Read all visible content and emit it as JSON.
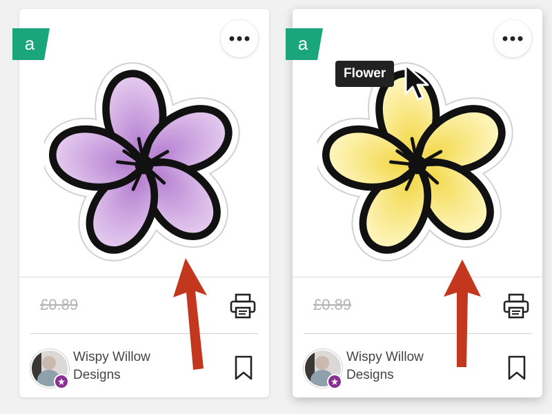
{
  "cards": [
    {
      "price": "£0.89",
      "designer": "Wispy Willow Designs",
      "badge_letter": "a",
      "petal_color": "#b57fd0",
      "petal_light": "#e6cdf0"
    },
    {
      "price": "£0.89",
      "designer": "Wispy Willow Designs",
      "badge_letter": "a",
      "petal_color": "#f2d84a",
      "petal_light": "#fff7c4"
    }
  ],
  "tooltip": {
    "text": "Flower"
  },
  "colors": {
    "badge": "#1aa67a",
    "arrow": "#c2371e",
    "price": "#b3b3b3"
  },
  "icons": [
    "more-icon",
    "print-icon",
    "bookmark-icon",
    "cursor-icon"
  ]
}
